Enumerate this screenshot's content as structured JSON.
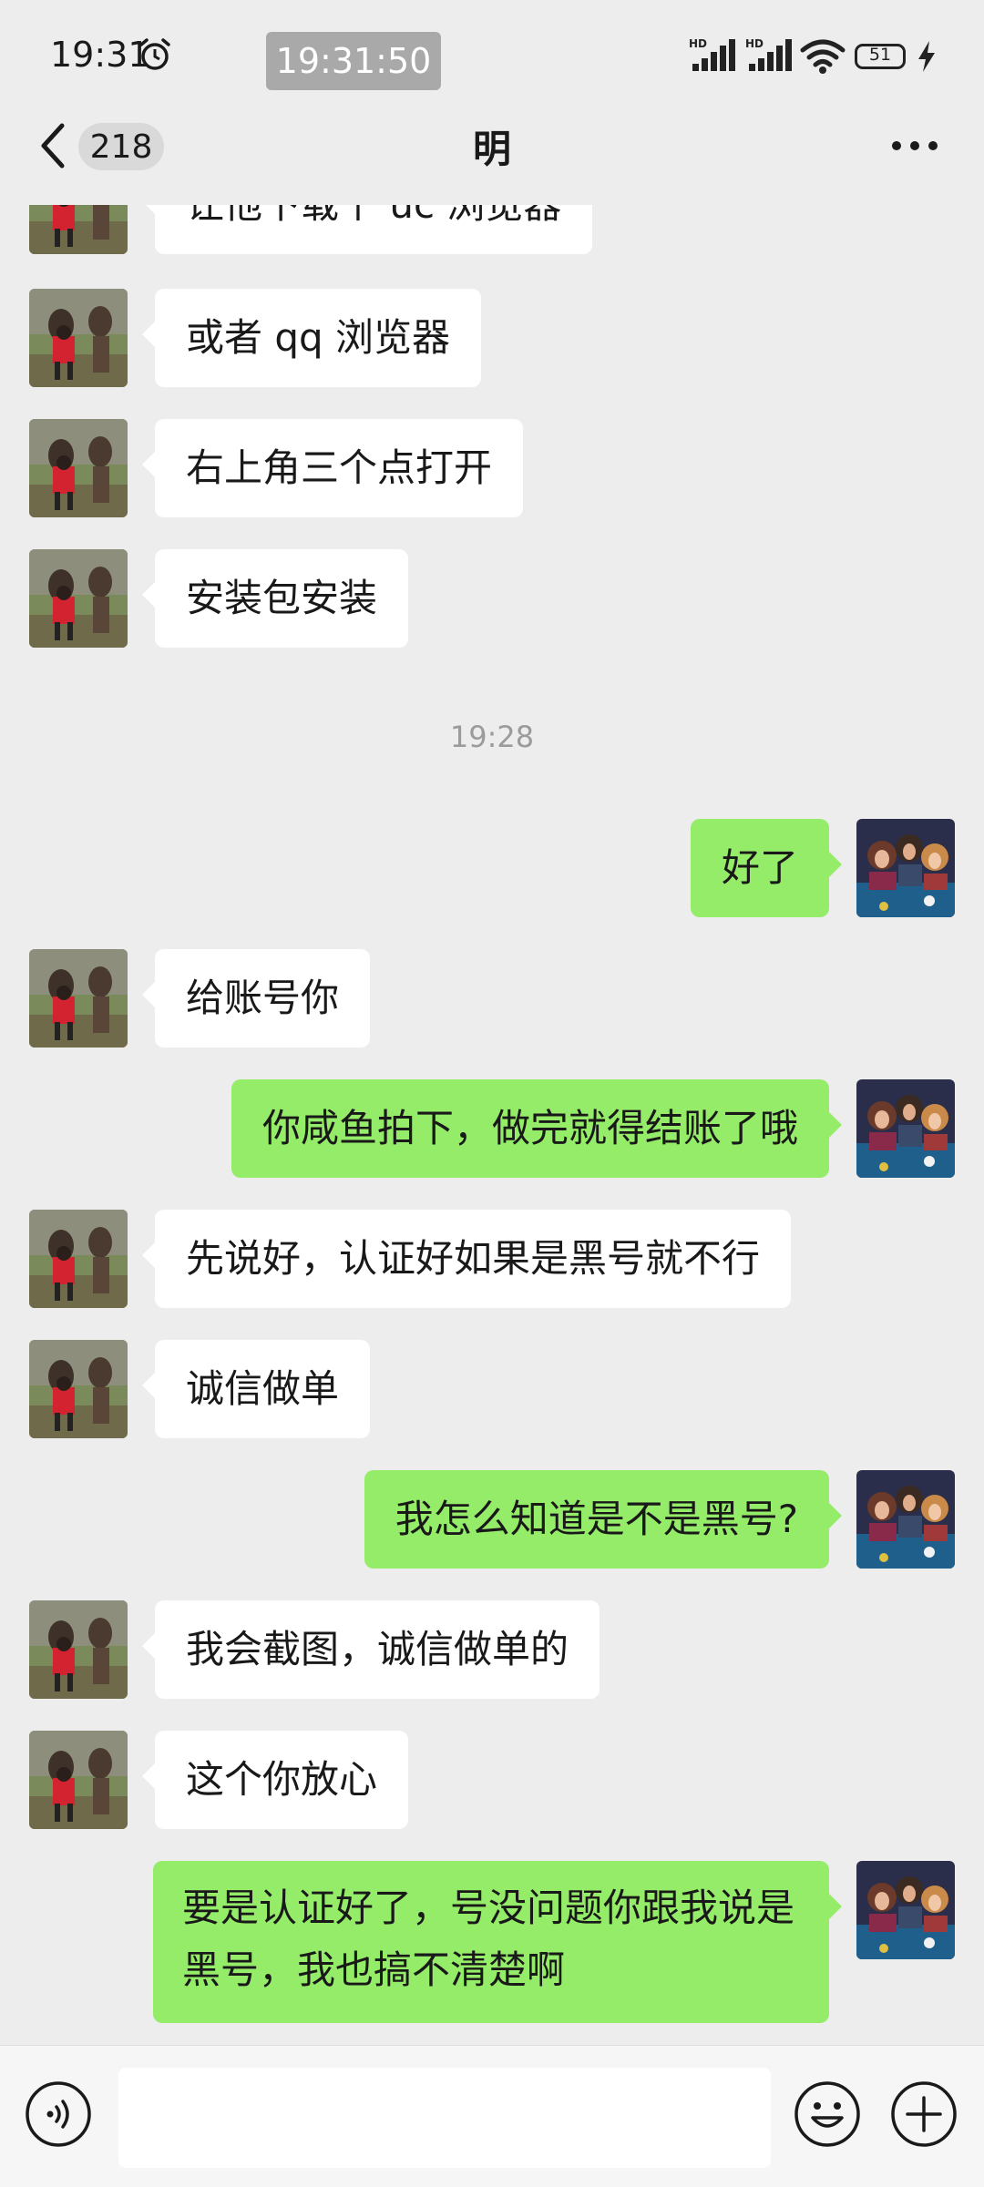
{
  "status_bar": {
    "time": "19:31",
    "center_time": "19:31:50",
    "signal_1_label": "HD",
    "signal_2_label": "HD",
    "battery": "51"
  },
  "header": {
    "unread_count": "218",
    "title": "明"
  },
  "messages": [
    {
      "side": "in",
      "text": "让他下载个 uc 浏览器"
    },
    {
      "side": "in",
      "text": "或者 qq 浏览器"
    },
    {
      "side": "in",
      "text": "右上角三个点打开"
    },
    {
      "side": "in",
      "text": "安装包安装"
    },
    {
      "side": "time",
      "text": "19:28"
    },
    {
      "side": "out",
      "text": "好了"
    },
    {
      "side": "in",
      "text": "给账号你"
    },
    {
      "side": "out",
      "text": "你咸鱼拍下，做完就得结账了哦"
    },
    {
      "side": "in",
      "text": "先说好，认证好如果是黑号就不行"
    },
    {
      "side": "in",
      "text": "诚信做单"
    },
    {
      "side": "out",
      "text": "我怎么知道是不是黑号?"
    },
    {
      "side": "in",
      "text": "我会截图，诚信做单的"
    },
    {
      "side": "in",
      "text": "这个你放心"
    },
    {
      "side": "out",
      "text": "要是认证好了，号没问题你跟我说是黑号，我也搞不清楚啊"
    }
  ],
  "input_bar": {
    "message_value": ""
  },
  "icons": [
    "alarm-icon",
    "signal-icon",
    "wifi-icon",
    "battery-icon",
    "charge-icon",
    "back-icon",
    "more-icon",
    "voice-icon",
    "emoji-icon",
    "plus-icon"
  ],
  "colors": {
    "background": "#ededed",
    "incoming_bubble": "#ffffff",
    "outgoing_bubble": "#95ec69",
    "timestamp": "#9b9b9b"
  }
}
